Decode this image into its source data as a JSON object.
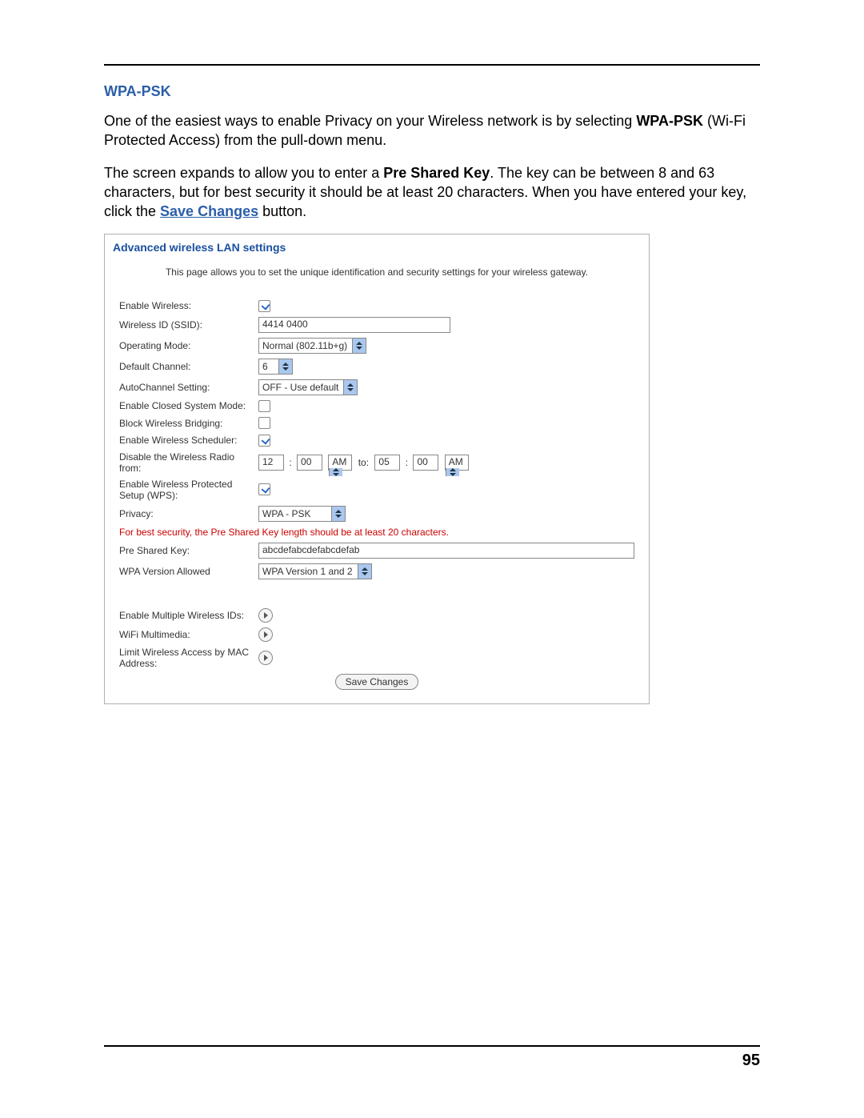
{
  "heading": "WPA-PSK",
  "para1_a": "One of the easiest ways to enable Privacy on your Wireless network is by selecting ",
  "para1_bold": "WPA-PSK",
  "para1_b": " (Wi-Fi Protected Access) from the pull-down menu.",
  "para2_a": "The screen expands to allow you to enter a ",
  "para2_bold": "Pre Shared Key",
  "para2_b": ". The key can be between 8 and 63 characters, but for best security it should be at least 20 characters. When you have entered your key, click the ",
  "para2_link": "Save Changes",
  "para2_c": " button.",
  "panel": {
    "title": "Advanced wireless LAN settings",
    "desc": "This page allows you to set the unique identification and security settings for your wireless gateway.",
    "labels": {
      "enable_wireless": "Enable Wireless:",
      "ssid": "Wireless ID (SSID):",
      "operating_mode": "Operating Mode:",
      "default_channel": "Default Channel:",
      "autochannel": "AutoChannel Setting:",
      "closed_system": "Enable Closed System Mode:",
      "block_bridging": "Block Wireless Bridging:",
      "scheduler": "Enable Wireless Scheduler:",
      "disable_radio": "Disable the Wireless Radio from:",
      "wps": "Enable Wireless Protected Setup (WPS):",
      "privacy": "Privacy:",
      "psk": "Pre Shared Key:",
      "wpa_version": "WPA Version Allowed",
      "multi_ids": "Enable Multiple Wireless IDs:",
      "wifi_mm": "WiFi Multimedia:",
      "mac_limit": "Limit Wireless Access by MAC Address:"
    },
    "values": {
      "ssid": "4414 0400",
      "operating_mode": "Normal (802.11b+g)",
      "default_channel": "6",
      "autochannel": "OFF - Use default",
      "time_from_h": "12",
      "time_from_m": "00",
      "time_from_ampm": "AM",
      "time_to_label": "to:",
      "time_to_h": "05",
      "time_to_m": "00",
      "time_to_ampm": "AM",
      "privacy": "WPA - PSK",
      "psk": "abcdefabcdefabcdefab",
      "wpa_version": "WPA Version 1 and 2"
    },
    "note": "For best security, the Pre Shared Key length should be at least 20 characters.",
    "save_button": "Save Changes"
  },
  "page_number": "95"
}
